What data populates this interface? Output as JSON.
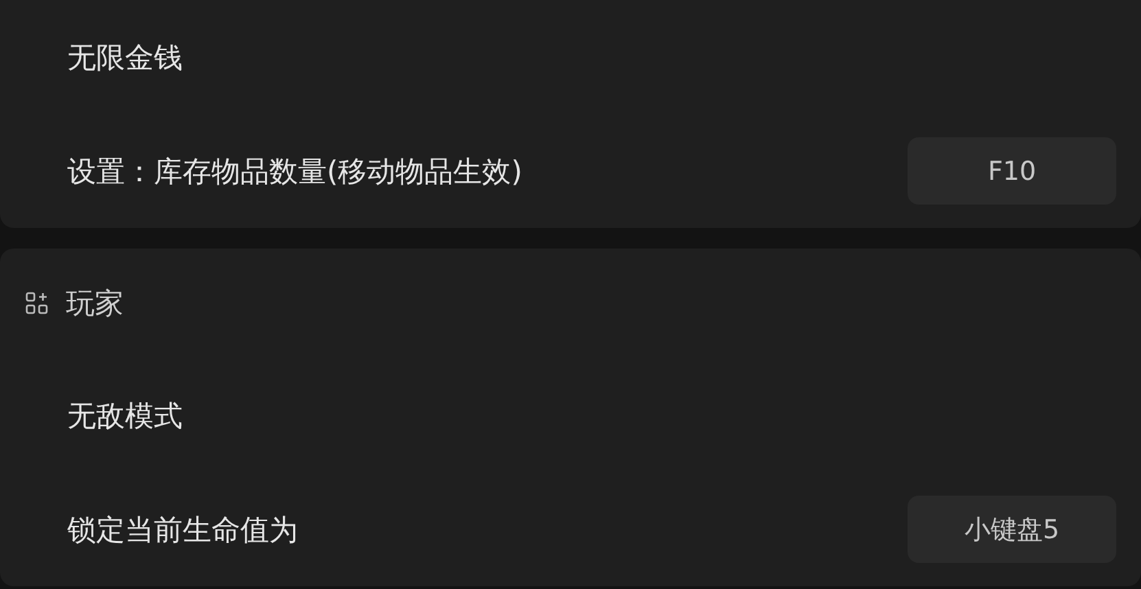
{
  "sections": [
    {
      "items": [
        {
          "label": "无限金钱"
        },
        {
          "label": "设置：库存物品数量(移动物品生效)",
          "hotkey": "F10"
        }
      ]
    },
    {
      "title": "玩家",
      "items": [
        {
          "label": "无敌模式"
        },
        {
          "label": "锁定当前生命值为",
          "hotkey": "小键盘5"
        }
      ]
    }
  ]
}
